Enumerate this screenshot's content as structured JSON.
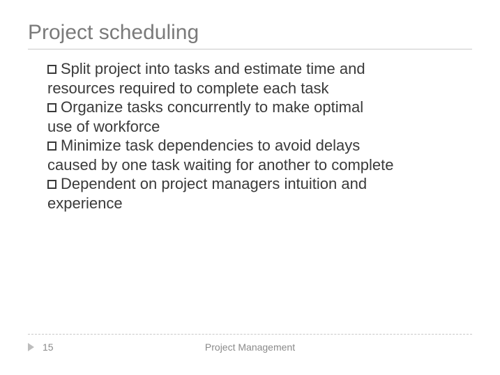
{
  "title": "Project scheduling",
  "bullets": [
    {
      "lead": "Split",
      "rest_first": " project into tasks and estimate time and",
      "rest_cont": "resources required to complete each task"
    },
    {
      "lead": "Organize",
      "rest_first": " tasks concurrently to make optimal",
      "rest_cont": "use of workforce"
    },
    {
      "lead": "Minimize",
      "rest_first": " task dependencies to avoid delays",
      "rest_cont": "caused by one task waiting for another to complete"
    },
    {
      "lead": "Dependent",
      "rest_first": " on project managers intuition and",
      "rest_cont": "experience"
    }
  ],
  "footer": {
    "page": "15",
    "label": "Project Management"
  }
}
